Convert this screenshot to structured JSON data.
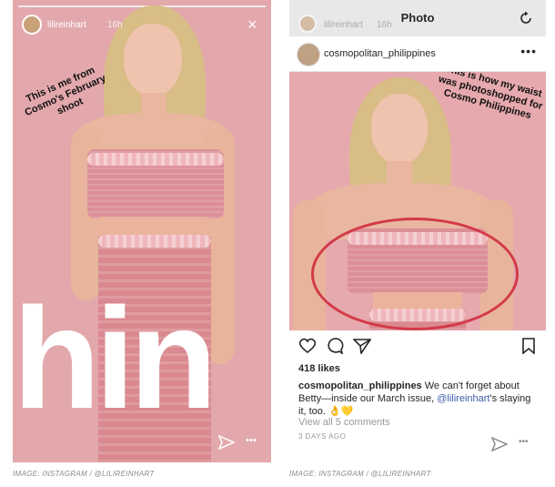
{
  "left_story": {
    "username": "lilireinhart",
    "time": "16h",
    "close_icon": "×",
    "caption": "This is me from Cosmo's February shoot",
    "big_text": "hin",
    "send_icon": "send-icon",
    "more_icon": "•••"
  },
  "right_post": {
    "topbar_title": "Photo",
    "topbar_ghost_user": "lilireinhart",
    "topbar_ghost_time": "16h",
    "username": "cosmopolitan_philippines",
    "more_icon": "•••",
    "photo_caption": "This is how my waist was photoshopped for Cosmo Philippines",
    "likes": "418 likes",
    "post_user": "cosmopolitan_philippines",
    "post_text_1": " We can't forget about Betty—inside our March issue, ",
    "post_mention": "@lilireinhart",
    "post_text_2": "'s slaying it, too. 👌💛",
    "view_comments": "View all 5 comments",
    "posted_ago": "3 DAYS AGO",
    "highlight_color": "#d33a48"
  },
  "credits": {
    "left": "IMAGE: INSTAGRAM / @LILIREINHART",
    "right": "IMAGE: INSTAGRAM / @LILIREINHART"
  }
}
